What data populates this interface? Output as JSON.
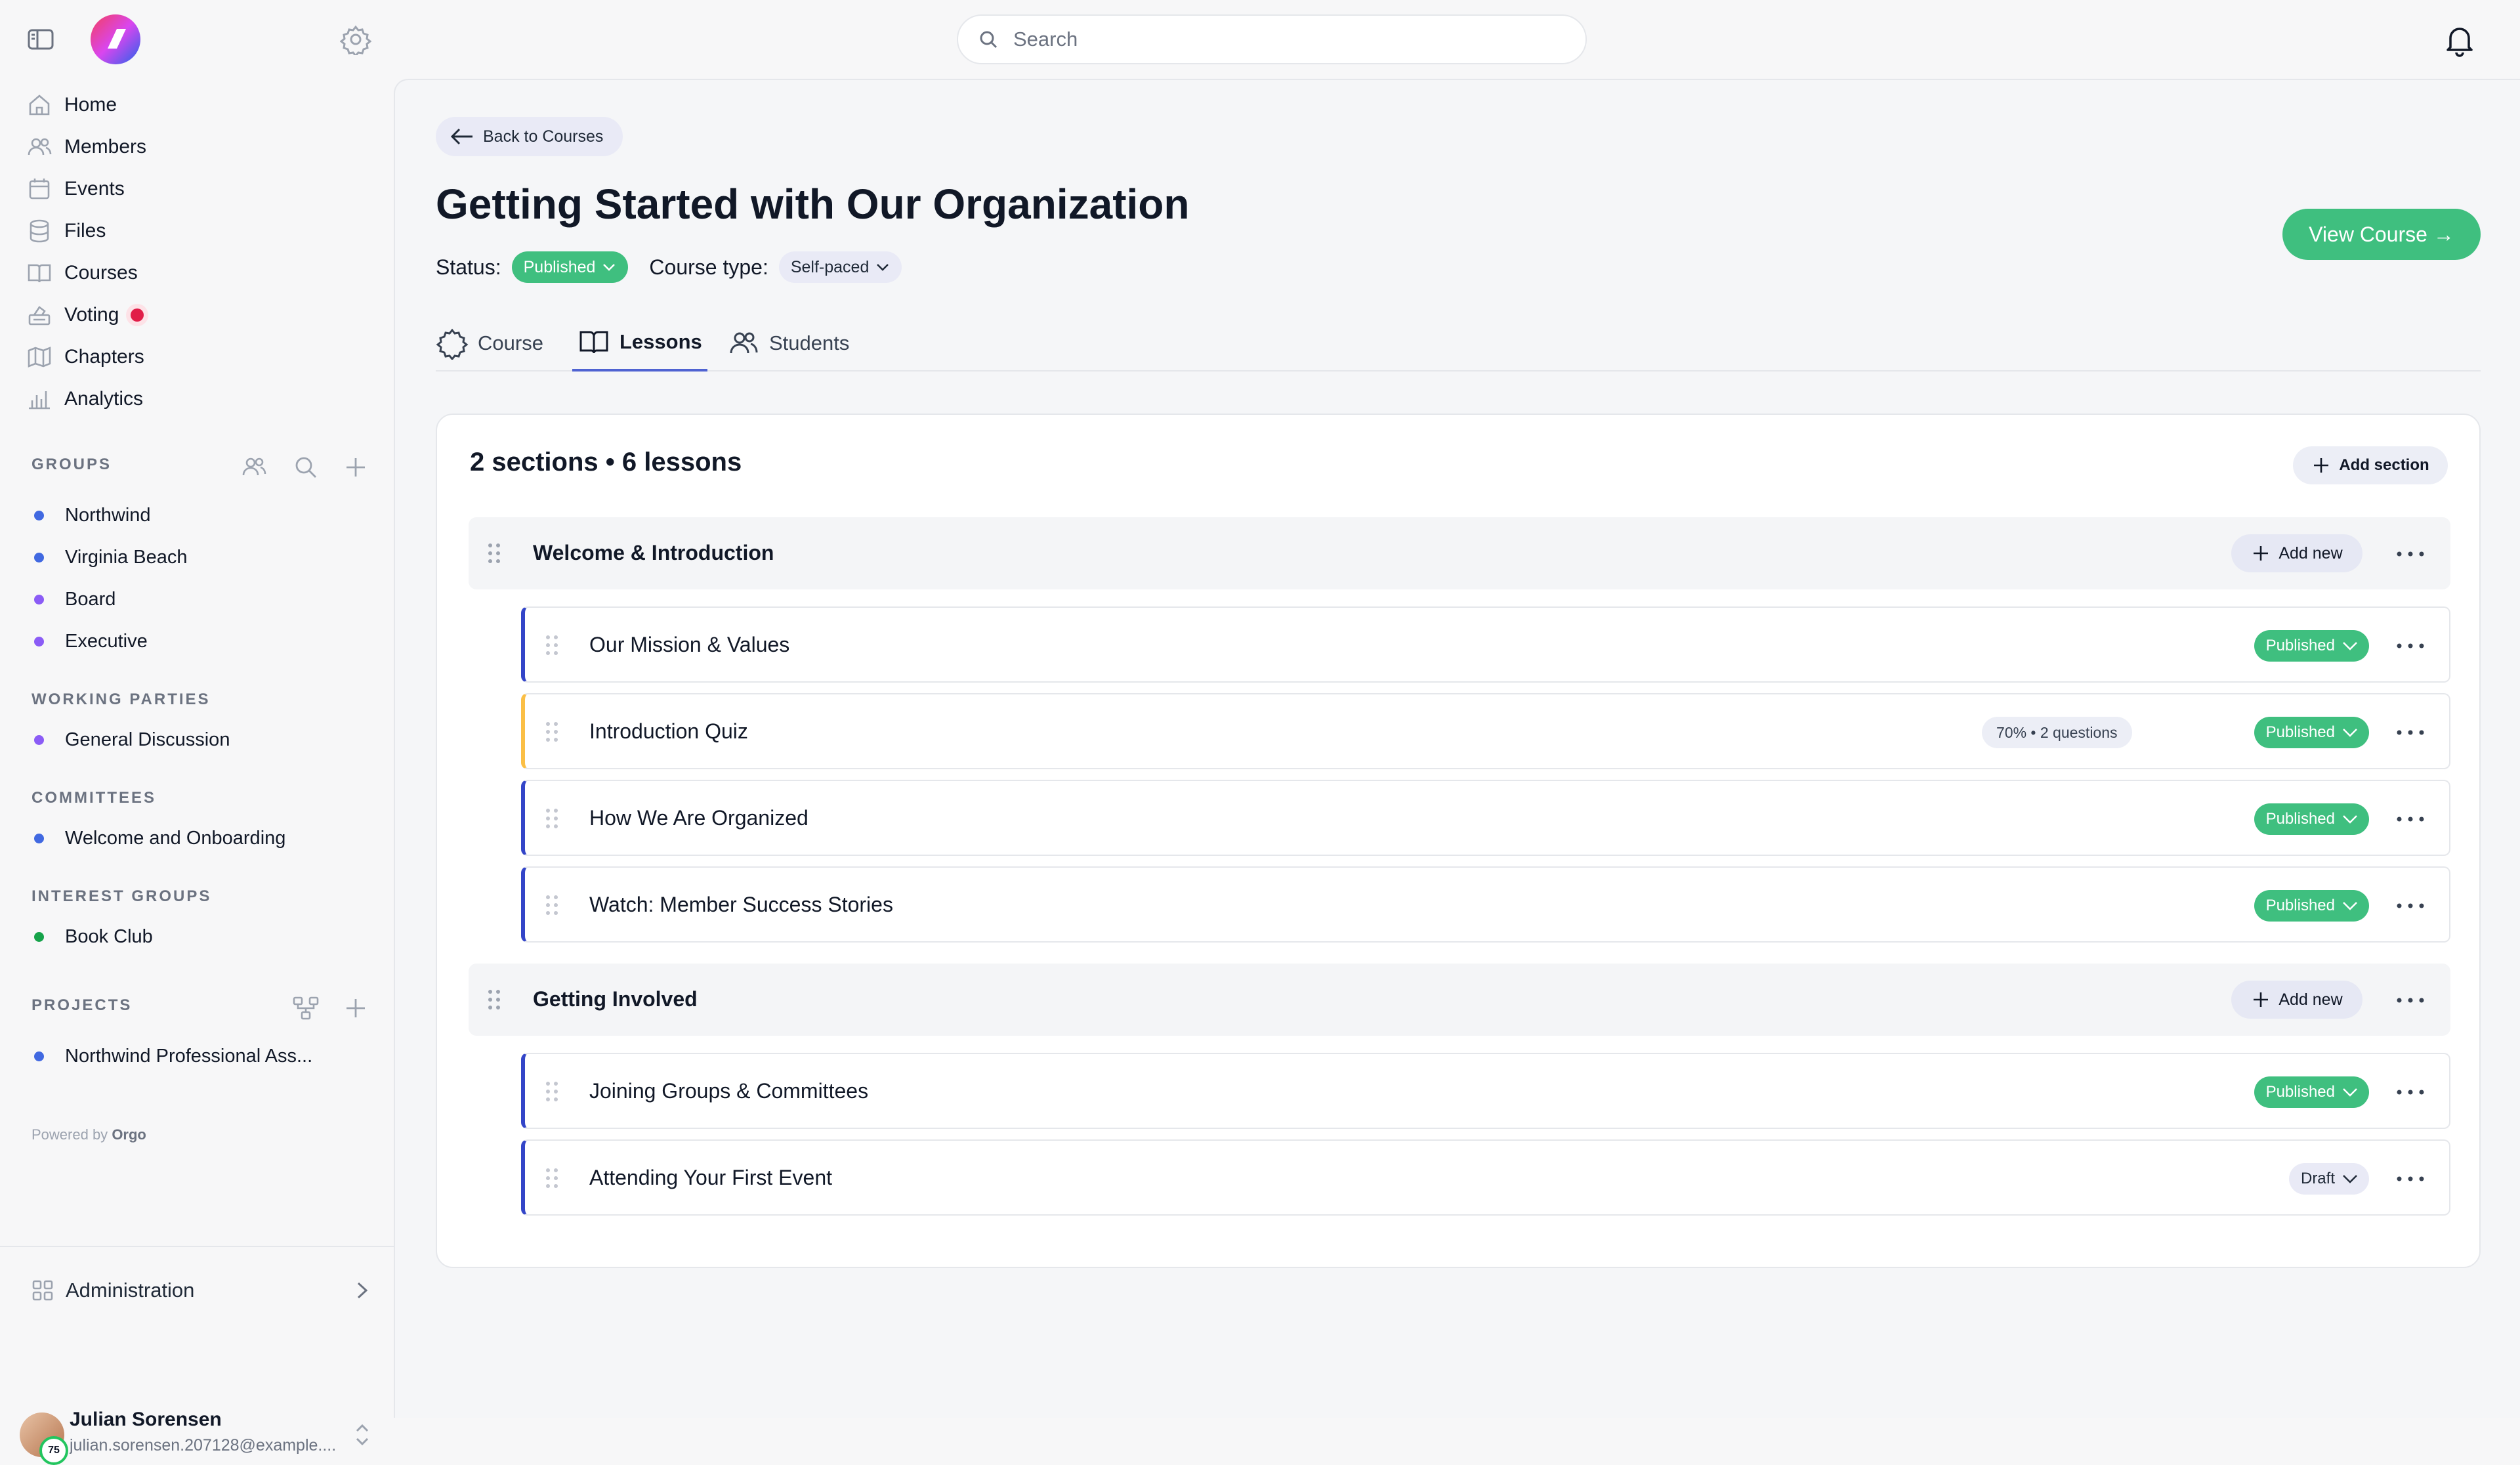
{
  "topbar": {
    "search_placeholder": "Search"
  },
  "sidebar": {
    "nav": [
      {
        "label": "Home",
        "icon": "home-icon"
      },
      {
        "label": "Members",
        "icon": "members-icon"
      },
      {
        "label": "Events",
        "icon": "calendar-icon"
      },
      {
        "label": "Files",
        "icon": "database-icon"
      },
      {
        "label": "Courses",
        "icon": "book-icon"
      },
      {
        "label": "Voting",
        "icon": "ballot-icon"
      },
      {
        "label": "Chapters",
        "icon": "map-icon"
      },
      {
        "label": "Analytics",
        "icon": "chart-icon"
      }
    ],
    "groups_title": "GROUPS",
    "groups": [
      {
        "label": "Northwind",
        "color": "#4169e1"
      },
      {
        "label": "Virginia Beach",
        "color": "#4169e1"
      },
      {
        "label": "Board",
        "color": "#8b5cf6"
      },
      {
        "label": "Executive",
        "color": "#8b5cf6"
      }
    ],
    "working_parties_title": "WORKING PARTIES",
    "working_parties": [
      {
        "label": "General Discussion",
        "color": "#8b5cf6"
      }
    ],
    "committees_title": "COMMITTEES",
    "committees": [
      {
        "label": "Welcome and Onboarding",
        "color": "#4169e1"
      }
    ],
    "interest_groups_title": "INTEREST GROUPS",
    "interest_groups": [
      {
        "label": "Book Club",
        "color": "#16a34a"
      }
    ],
    "projects_title": "PROJECTS",
    "projects": [
      {
        "label": "Northwind Professional Ass...",
        "color": "#4169e1"
      }
    ],
    "powered_prefix": "Powered by",
    "powered_brand": "Orgo",
    "admin_label": "Administration",
    "user": {
      "name": "Julian Sorensen",
      "email": "julian.sorensen.207128@example....",
      "badge": "75"
    }
  },
  "main": {
    "back_label": "Back to Courses",
    "title": "Getting Started with Our Organization",
    "status_label": "Status:",
    "status_value": "Published",
    "course_type_label": "Course type:",
    "course_type_value": "Self-paced",
    "view_course_label": "View Course →",
    "tabs": [
      {
        "label": "Course",
        "active": false
      },
      {
        "label": "Lessons",
        "active": true
      },
      {
        "label": "Students",
        "active": false
      }
    ],
    "counts": "2 sections • 6 lessons",
    "add_section_label": "Add section",
    "add_new_label": "Add new",
    "sections": [
      {
        "title": "Welcome & Introduction",
        "lessons": [
          {
            "name": "Our Mission & Values",
            "status": "Published"
          },
          {
            "name": "Introduction Quiz",
            "status": "Published",
            "badge": "70% • 2 questions"
          },
          {
            "name": "How We Are Organized",
            "status": "Published"
          },
          {
            "name": "Watch: Member Success Stories",
            "status": "Published"
          }
        ]
      },
      {
        "title": "Getting Involved",
        "lessons": [
          {
            "name": "Joining Groups & Committees",
            "status": "Published"
          },
          {
            "name": "Attending Your First Event",
            "status": "Draft"
          }
        ]
      }
    ]
  },
  "colors": {
    "accent_green": "#3fbf7f",
    "lesson_border": "#3345c8",
    "quiz_border": "#fbbf45",
    "tab_underline": "#4f63d2"
  }
}
